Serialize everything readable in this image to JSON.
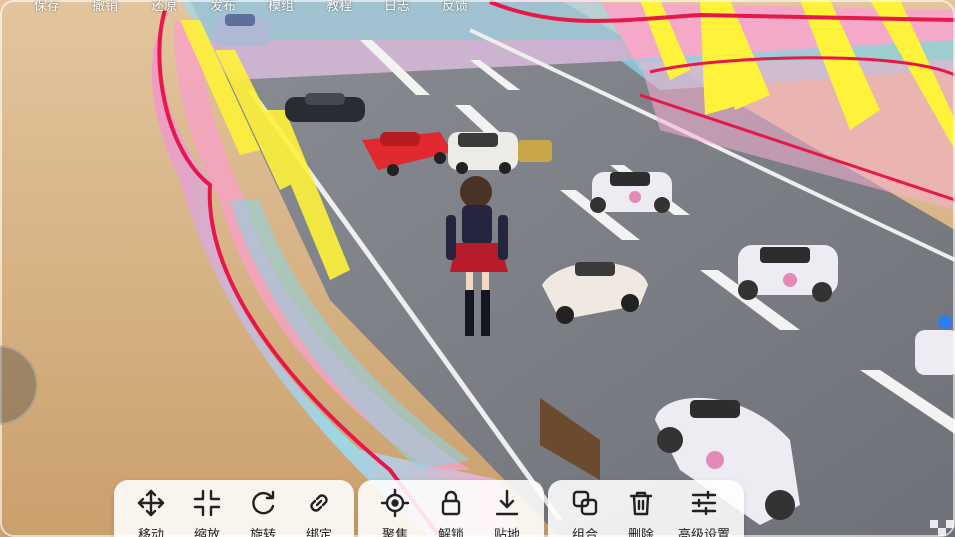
{
  "top_menu": [
    {
      "label": "保存"
    },
    {
      "label": "撤销"
    },
    {
      "label": "还原"
    },
    {
      "label": "发布"
    },
    {
      "label": "模组"
    },
    {
      "label": "教程"
    },
    {
      "label": "日志"
    },
    {
      "label": "反馈"
    }
  ],
  "toolbar": {
    "transform": [
      {
        "label": "移动",
        "icon": "move-icon"
      },
      {
        "label": "缩放",
        "icon": "scale-icon"
      },
      {
        "label": "旋转",
        "icon": "rotate-icon"
      },
      {
        "label": "绑定",
        "icon": "link-icon"
      }
    ],
    "placement": [
      {
        "label": "聚焦",
        "icon": "focus-icon"
      },
      {
        "label": "解锁",
        "icon": "lock-icon"
      },
      {
        "label": "贴地",
        "icon": "snap-to-ground-icon"
      }
    ],
    "edit": [
      {
        "label": "组合",
        "icon": "group-icon"
      },
      {
        "label": "删除",
        "icon": "trash-icon"
      },
      {
        "label": "高级设置",
        "icon": "sliders-icon"
      }
    ]
  },
  "colors": {
    "road": "#7d7f86",
    "sand": "#d6b68c",
    "barrier_pink": "#f48ab6",
    "barrier_cyan": "#7fd3e0",
    "accent_yellow": "#fff23a",
    "edge_red": "#e8174a"
  }
}
